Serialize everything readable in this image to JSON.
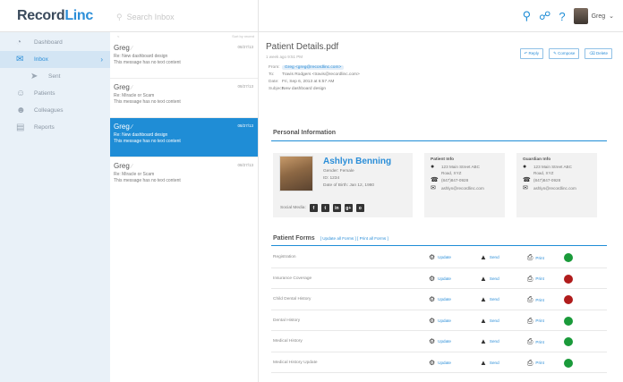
{
  "header": {
    "logo_pre": "Record",
    "logo_accent": "Linc",
    "search_placeholder": "Search Inbox",
    "user_name": "Greg"
  },
  "sidebar": {
    "items": [
      {
        "label": "Dashboard",
        "icon": "gauge-icon"
      },
      {
        "label": "Inbox",
        "icon": "envelope-icon"
      },
      {
        "label": "Sent",
        "icon": "paper-plane-icon"
      },
      {
        "label": "Patients",
        "icon": "people-icon"
      },
      {
        "label": "Colleagues",
        "icon": "group-icon"
      },
      {
        "label": "Reports",
        "icon": "chart-icon"
      }
    ]
  },
  "list": {
    "head_left": "<",
    "head_right": "Sort by recent",
    "messages": [
      {
        "from": "Greg",
        "date": "08/27/13",
        "subject": "Re: New dashboard design",
        "preview": "This message has no text content"
      },
      {
        "from": "Greg",
        "date": "08/27/13",
        "subject": "Re: Miracle or Scam",
        "preview": "This message has no text content"
      },
      {
        "from": "Greg",
        "date": "08/27/13",
        "subject": "Re: New dashboard design",
        "preview": "This message has no text content"
      },
      {
        "from": "Greg",
        "date": "08/27/13",
        "subject": "Re: Miracle or Scam",
        "preview": "This message has no text content"
      }
    ]
  },
  "detail": {
    "title": "Patient Details.pdf",
    "meta": "1 week ago 9:51 PM",
    "actions": [
      "Reply",
      "Compose",
      "Delete"
    ],
    "from_label": "From:",
    "from_value": "Greg <greg@recordlinc.com>",
    "to_label": "To:",
    "to_value": "Travis Rodgers <travis@recordlinc.com>",
    "date_label": "Date:",
    "date_value": "Fri, Sep 6, 2013 at 6:57 AM",
    "subject_label": "Subject:",
    "subject_value": "New dashboard design"
  },
  "personal": {
    "section_title": "Personal Information",
    "name": "Ashlyn Benning",
    "gender": "Gender: Female",
    "id": "ID: 1234",
    "dob": "Date of Birth: Jan 12, 1980",
    "social_label": "Social Media:",
    "social": [
      "f",
      "t",
      "in",
      "g+",
      "o"
    ],
    "patient_info": {
      "title": "Patient Info",
      "address1": "123 Main Street ABC",
      "address2": "Road, XYZ",
      "phone": "(847)847-0928",
      "email": "ashlyn@recordlinc.com"
    },
    "guardian_info": {
      "title": "Guardian Info",
      "address1": "123 Main Street ABC",
      "address2": "Road, XYZ",
      "phone": "(847)847-0928",
      "email": "ashlyn@recordlinc.com"
    }
  },
  "forms": {
    "title": "Patient Forms",
    "links": "[ Update all Forms ] [ Print all Forms ]",
    "update_label": "Update",
    "send_label": "Send",
    "print_label": "Print",
    "rows": [
      {
        "name": "Registration",
        "status_color": "#1a9a3a"
      },
      {
        "name": "Insurance Coverage",
        "status_color": "#b01c1c"
      },
      {
        "name": "Child Dental History",
        "status_color": "#b01c1c"
      },
      {
        "name": "Dental History",
        "status_color": "#1a9a3a"
      },
      {
        "name": "Medical History",
        "status_color": "#1a9a3a"
      },
      {
        "name": "Medical History Update",
        "status_color": "#1a9a3a"
      }
    ]
  },
  "colors": {
    "accent": "#1f8dd6",
    "sidebar_bg": "#e9f1f8"
  }
}
